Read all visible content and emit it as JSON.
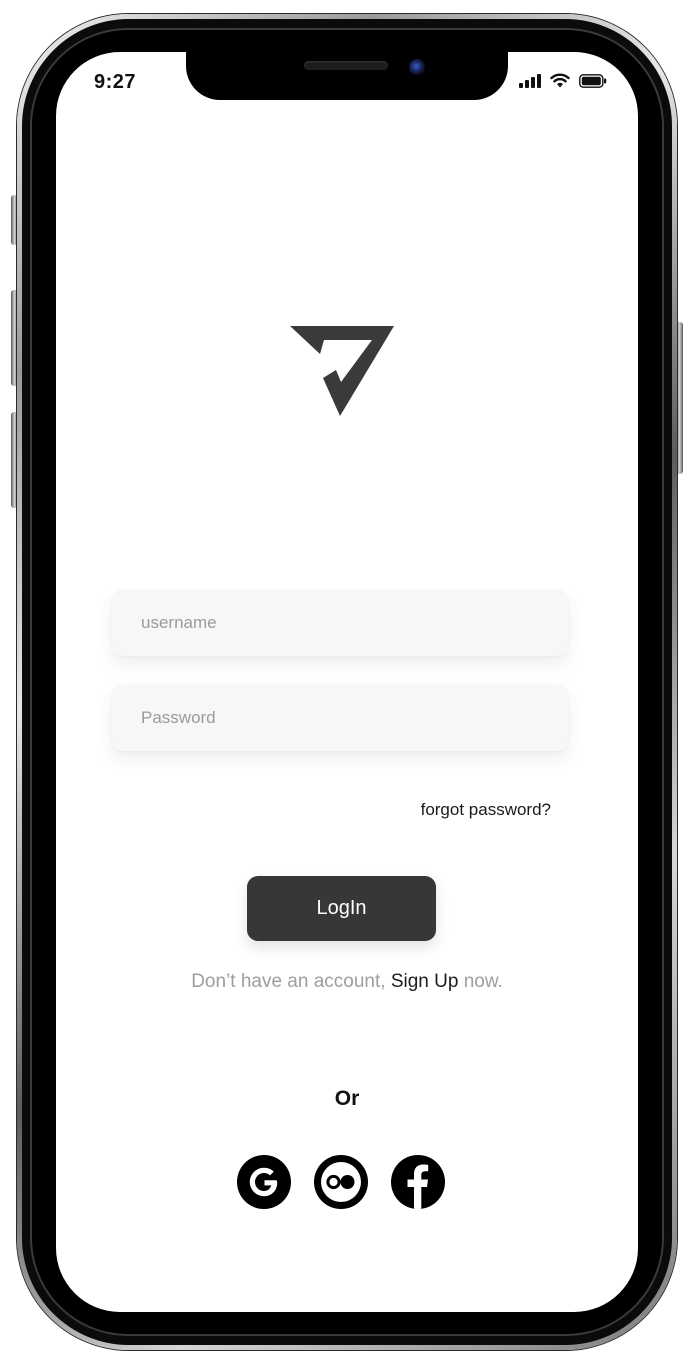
{
  "status_bar": {
    "time": "9:27"
  },
  "login_form": {
    "username_placeholder": "username",
    "password_placeholder": "Password",
    "forgot_password_label": "forgot password?",
    "login_button_label": "LogIn"
  },
  "signup_prompt": {
    "prefix": "Don’t have an account, ",
    "link_label": "Sign Up",
    "suffix": " now."
  },
  "social_login": {
    "divider_label": "Or",
    "providers": [
      {
        "icon": "google-icon"
      },
      {
        "icon": "flickr-icon"
      },
      {
        "icon": "facebook-icon"
      }
    ]
  },
  "colors": {
    "button_bg": "#373737",
    "input_bg": "#f7f7f7",
    "muted_text": "#9e9e9e",
    "logo": "#3a3a3a"
  }
}
